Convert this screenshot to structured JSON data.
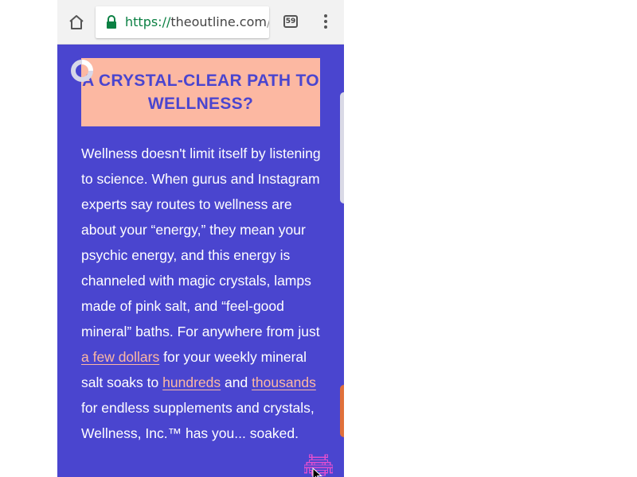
{
  "browser": {
    "url_scheme": "https://",
    "url_host": "theoutline.com",
    "url_tail": "/p",
    "tab_count": "59",
    "icons": {
      "home": "home-icon",
      "lock": "lock-icon",
      "tabs": "tabs-icon",
      "menu": "more-vert-icon"
    }
  },
  "article": {
    "title": "A CRYSTAL-CLEAR PATH TO WELLNESS?",
    "p1": "Wellness doesn't limit itself by listening to science. When gurus and Instagram experts say routes to wellness are about your “energy,” they mean your psychic energy, and this energy is channeled with magic crystals, lamps made of pink salt, and “feel-good mineral” baths. For anywhere from just ",
    "link1": "a few dollars",
    "p2": " for your weekly mineral salt soaks to ",
    "link2": "hundreds",
    "p3": " and ",
    "link3": "thousands",
    "p4": " for endless supplements and crystals, Wellness, Inc.™ has you... soaked."
  },
  "colors": {
    "background": "#4a45cf",
    "title_box": "#fcb8a2",
    "link": "#fcb8a2",
    "url_scheme": "#0b8043"
  },
  "decor": {
    "corner_icon": "space-invader-icon",
    "loader": "loading-ring-icon"
  }
}
